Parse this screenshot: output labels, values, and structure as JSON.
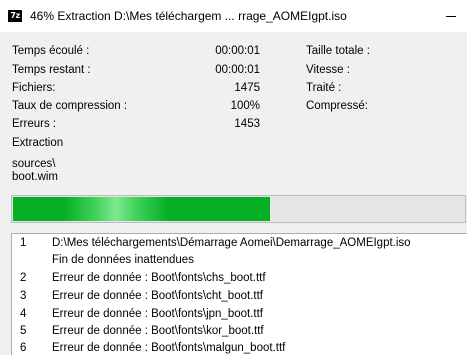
{
  "window": {
    "icon_text": "7z",
    "title": "46% Extraction D:\\Mes téléchargem ... rrage_AOMEIgpt.iso",
    "minimize_icon": "minimize-icon"
  },
  "stats_left": [
    {
      "label": "Temps écoulé :",
      "value": "00:00:01"
    },
    {
      "label": "Temps restant :",
      "value": "00:00:01"
    },
    {
      "label": "Fichiers:",
      "value": "1475"
    },
    {
      "label": "Taux de compression :",
      "value": "100%"
    },
    {
      "label": "Erreurs :",
      "value": "1453"
    }
  ],
  "stats_right": [
    {
      "label": "Taille totale :",
      "value": ""
    },
    {
      "label": "Vitesse :",
      "value": ""
    },
    {
      "label": "Traité :",
      "value": ""
    },
    {
      "label": "Compressé:",
      "value": ""
    }
  ],
  "operation": "Extraction",
  "current_path": "sources\\",
  "current_file": "boot.wim",
  "progress": {
    "percent": 46,
    "color": "#06b025"
  },
  "log": [
    {
      "num": "1",
      "text": "D:\\Mes téléchargements\\Démarrage Aomei\\Demarrage_AOMEIgpt.iso"
    },
    {
      "num": "",
      "text": "Fin de données inattendues"
    },
    {
      "num": "2",
      "text": "Erreur de donnée : Boot\\fonts\\chs_boot.ttf"
    },
    {
      "num": "3",
      "text": "Erreur de donnée : Boot\\fonts\\cht_boot.ttf"
    },
    {
      "num": "4",
      "text": "Erreur de donnée : Boot\\fonts\\jpn_boot.ttf"
    },
    {
      "num": "5",
      "text": "Erreur de donnée : Boot\\fonts\\kor_boot.ttf"
    },
    {
      "num": "6",
      "text": "Erreur de donnée : Boot\\fonts\\malgun_boot.ttf"
    }
  ]
}
